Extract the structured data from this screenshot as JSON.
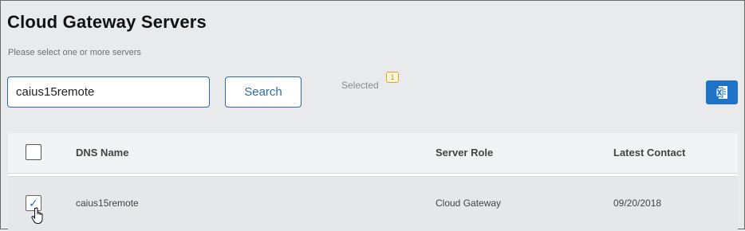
{
  "page": {
    "title": "Cloud Gateway Servers",
    "subtitle": "Please select one or more servers"
  },
  "search": {
    "value": "caius15remote",
    "button_label": "Search"
  },
  "selection": {
    "label": "Selected",
    "count": "1"
  },
  "toolbar": {
    "export_icon": "excel-icon",
    "accent_color": "#1e73c8"
  },
  "table": {
    "columns": [
      "DNS Name",
      "Server Role",
      "Latest Contact"
    ],
    "rows": [
      {
        "checked": true,
        "dns_name": "caius15remote",
        "server_role": "Cloud Gateway",
        "latest_contact": "09/20/2018"
      }
    ]
  }
}
